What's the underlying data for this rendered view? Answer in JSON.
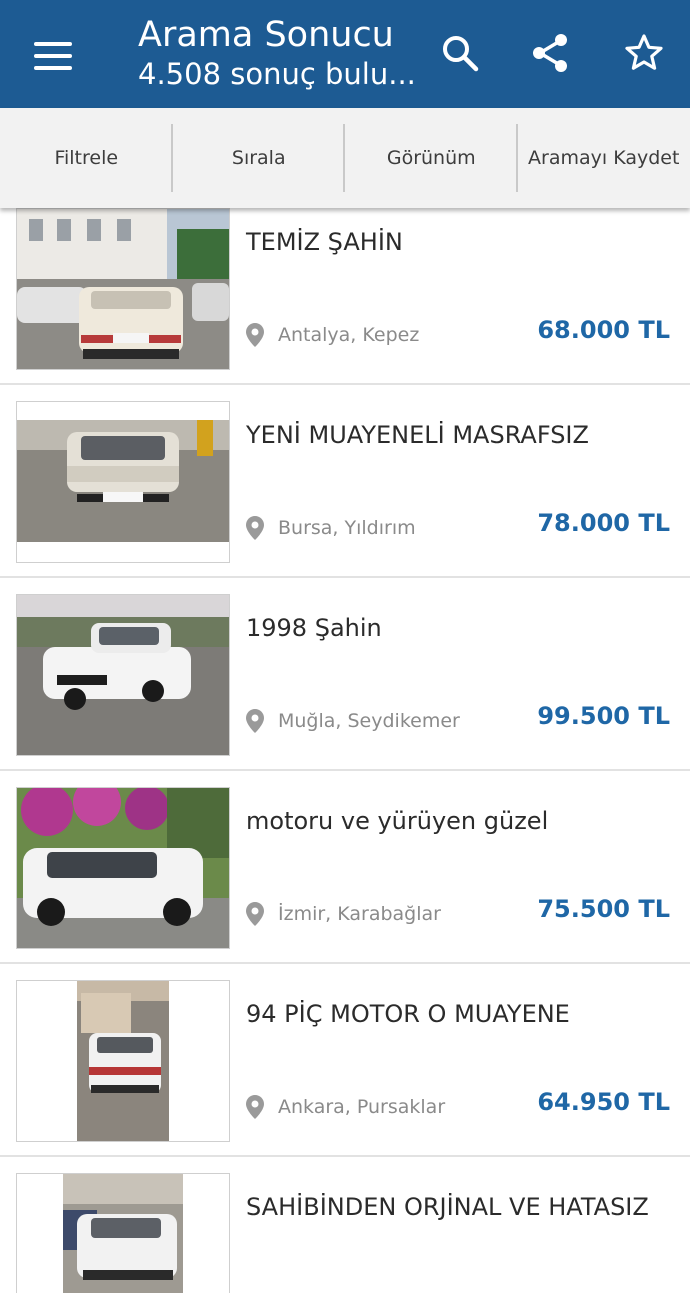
{
  "appbar": {
    "title": "Arama Sonucu",
    "subtitle": "4.508 sonuç bulu...",
    "icons": [
      "menu-icon",
      "search-icon",
      "share-icon",
      "star-icon"
    ],
    "background": "#1d5b93"
  },
  "tabs": [
    {
      "label": "Filtrele"
    },
    {
      "label": "Sırala"
    },
    {
      "label": "Görünüm"
    },
    {
      "label": "Aramayı Kaydet"
    }
  ],
  "listings": [
    {
      "title": "TEMİZ ŞAHİN",
      "location": "Antalya, Kepez",
      "price": "68.000 TL"
    },
    {
      "title": "YENİ MUAYENELİ MASRAFSIZ",
      "location": "Bursa, Yıldırım",
      "price": "78.000 TL"
    },
    {
      "title": "1998 Şahin",
      "location": "Muğla, Seydikemer",
      "price": "99.500 TL"
    },
    {
      "title": "motoru ve yürüyen güzel",
      "location": "İzmir, Karabağlar",
      "price": "75.500 TL"
    },
    {
      "title": "94 PİÇ MOTOR O MUAYENE",
      "location": "Ankara, Pursaklar",
      "price": "64.950 TL"
    },
    {
      "title": "SAHİBİNDEN ORJİNAL VE HATASIZ",
      "location": "",
      "price": ""
    }
  ],
  "colors": {
    "price": "#1f67a6",
    "location": "#8a8a8a",
    "accent": "#1d5b93"
  }
}
